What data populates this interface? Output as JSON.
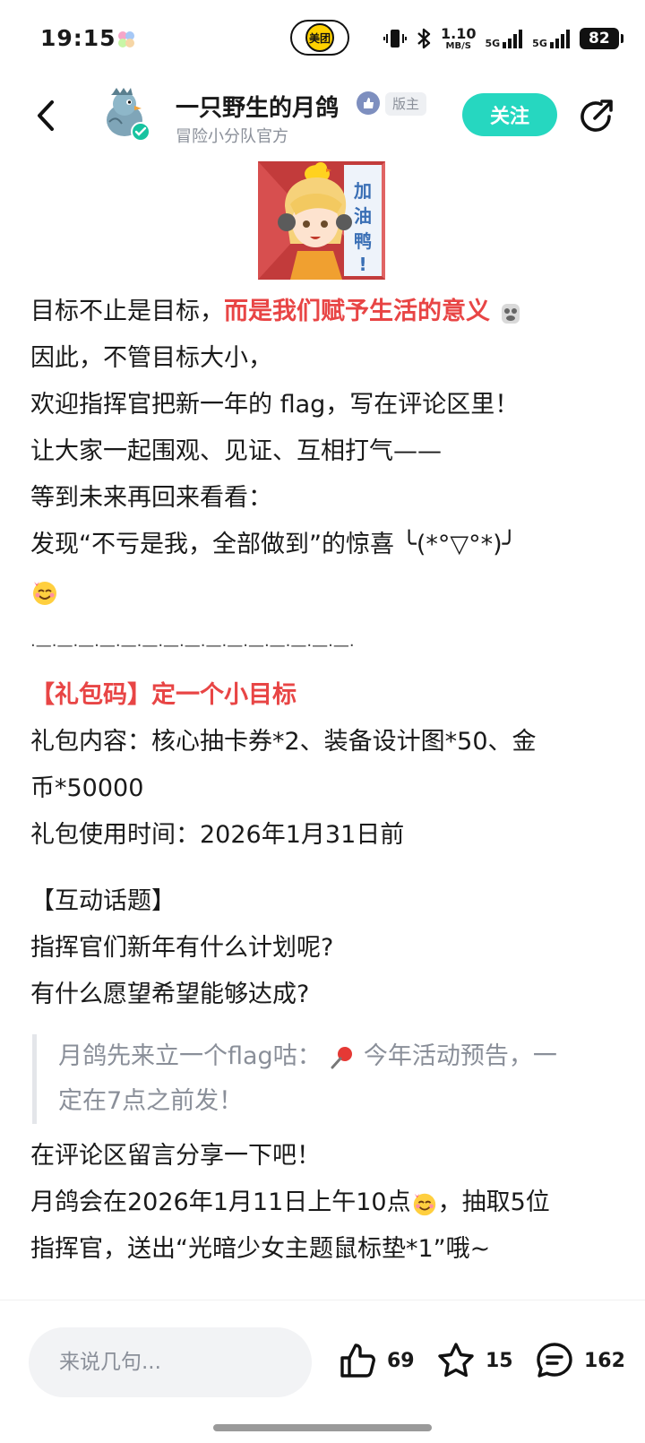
{
  "status_bar": {
    "time": "19:15",
    "meituan_label": "美团",
    "net_speed_value": "1.10",
    "net_speed_unit": "MB/S",
    "signal1_label": "5G",
    "signal2_label": "5G",
    "battery": "82"
  },
  "header": {
    "author_name": "一只野生的月鸽",
    "author_role": "版主",
    "author_subtitle": "冒险小分队官方",
    "follow_label": "关注"
  },
  "sticker": {
    "text": "加油鸭！"
  },
  "post": {
    "intro_lines": [
      {
        "plain": "目标不止是目标，",
        "highlight": "而是我们赋予生活的意义"
      },
      {
        "plain": "因此，不管目标大小，"
      },
      {
        "plain": "欢迎指挥官把新一年的 flag，写在评论区里！"
      },
      {
        "plain": "让大家一起围观、见证、互相打气——"
      },
      {
        "plain": "等到未来再回来看看："
      },
      {
        "plain": "发现“不亏是我，全部做到”的惊喜 ╰(*°▽°*)╯"
      }
    ],
    "divider": "·—·—·—·—·—·—·—·—·—·—·—·—·—·—·—·",
    "gift_title": "【礼包码】定一个小目标",
    "gift_content_1": "礼包内容：核心抽卡券*2、装备设计图*50、金",
    "gift_content_2": "币*50000",
    "gift_time": "礼包使用时间：2026年1月31日前",
    "topic_title": "【互动话题】",
    "topic_q1": "指挥官们新年有什么计划呢?",
    "topic_q2": "有什么愿望希望能够达成?",
    "quote_1_pre": "月鸽先来立一个flag咕：",
    "quote_1_post": " 今年活动预告，一",
    "quote_2": "定在7点之前发！",
    "share_line": "在评论区留言分享一下吧！",
    "lottery_1_pre": "月鸽会在2026年1月11日上午10点",
    "lottery_1_post": "，抽取5位",
    "lottery_2": "指挥官，送出“光暗少女主题鼠标垫*1”哦~"
  },
  "bottom_bar": {
    "comment_placeholder": "来说几句...",
    "like_count": "69",
    "favorite_count": "15",
    "comment_count": "162"
  },
  "colors": {
    "accent": "#26d7c0",
    "highlight_red": "#e84545",
    "muted": "#8a8f99"
  }
}
